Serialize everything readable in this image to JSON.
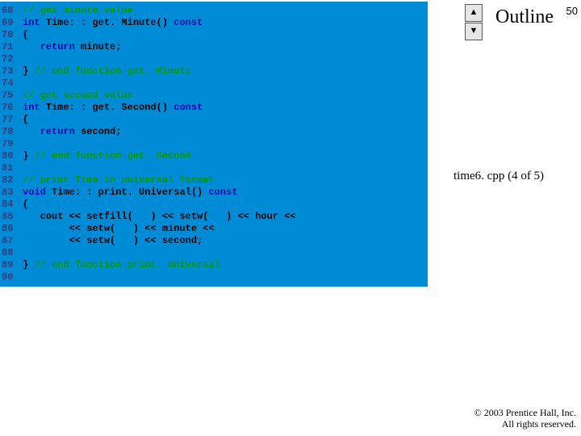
{
  "header": {
    "outline_label": "Outline",
    "page_number": "50"
  },
  "sidebar": {
    "file_label": "time6. cpp (4 of 5)"
  },
  "footer": {
    "copyright_line1": "© 2003 Prentice Hall, Inc.",
    "copyright_line2": "All rights reserved."
  },
  "nav": {
    "up_glyph": "▲",
    "down_glyph": "▼"
  },
  "code": {
    "lines": [
      {
        "n": "68",
        "tokens": [
          {
            "c": "comment",
            "t": "// get minute value"
          }
        ]
      },
      {
        "n": "69",
        "tokens": [
          {
            "c": "keyword",
            "t": "int"
          },
          {
            "c": "default",
            "t": " Time: : get. Minute() "
          },
          {
            "c": "keyword",
            "t": "const"
          }
        ]
      },
      {
        "n": "70",
        "tokens": [
          {
            "c": "default",
            "t": "{"
          }
        ]
      },
      {
        "n": "71",
        "tokens": [
          {
            "c": "default",
            "t": "   "
          },
          {
            "c": "keyword",
            "t": "return"
          },
          {
            "c": "default",
            "t": " minute;"
          }
        ]
      },
      {
        "n": "72",
        "tokens": []
      },
      {
        "n": "73",
        "tokens": [
          {
            "c": "default",
            "t": "} "
          },
          {
            "c": "comment",
            "t": "// end function get. Minute"
          }
        ]
      },
      {
        "n": "74",
        "tokens": []
      },
      {
        "n": "75",
        "tokens": [
          {
            "c": "comment",
            "t": "// get second value"
          }
        ]
      },
      {
        "n": "76",
        "tokens": [
          {
            "c": "keyword",
            "t": "int"
          },
          {
            "c": "default",
            "t": " Time: : get. Second() "
          },
          {
            "c": "keyword",
            "t": "const"
          }
        ]
      },
      {
        "n": "77",
        "tokens": [
          {
            "c": "default",
            "t": "{"
          }
        ]
      },
      {
        "n": "78",
        "tokens": [
          {
            "c": "default",
            "t": "   "
          },
          {
            "c": "keyword",
            "t": "return"
          },
          {
            "c": "default",
            "t": " second;"
          }
        ]
      },
      {
        "n": "79",
        "tokens": []
      },
      {
        "n": "80",
        "tokens": [
          {
            "c": "default",
            "t": "} "
          },
          {
            "c": "comment",
            "t": "// end function get. Second"
          }
        ]
      },
      {
        "n": "81",
        "tokens": []
      },
      {
        "n": "82",
        "tokens": [
          {
            "c": "comment",
            "t": "// print Time in universal format"
          }
        ]
      },
      {
        "n": "83",
        "tokens": [
          {
            "c": "keyword",
            "t": "void"
          },
          {
            "c": "default",
            "t": " Time: : print. Universal() "
          },
          {
            "c": "keyword",
            "t": "const"
          }
        ]
      },
      {
        "n": "84",
        "tokens": [
          {
            "c": "default",
            "t": "{"
          }
        ]
      },
      {
        "n": "85",
        "tokens": [
          {
            "c": "default",
            "t": "   cout << setfill( "
          },
          {
            "c": "string",
            "t": " "
          },
          {
            "c": "default",
            "t": " ) << setw( "
          },
          {
            "c": "string",
            "t": " "
          },
          {
            "c": "default",
            "t": " ) << hour << "
          },
          {
            "c": "string",
            "t": " "
          }
        ]
      },
      {
        "n": "86",
        "tokens": [
          {
            "c": "default",
            "t": "        << setw( "
          },
          {
            "c": "string",
            "t": " "
          },
          {
            "c": "default",
            "t": " ) << minute << "
          },
          {
            "c": "string",
            "t": " "
          }
        ]
      },
      {
        "n": "87",
        "tokens": [
          {
            "c": "default",
            "t": "        << setw( "
          },
          {
            "c": "string",
            "t": " "
          },
          {
            "c": "default",
            "t": " ) << second;"
          }
        ]
      },
      {
        "n": "88",
        "tokens": []
      },
      {
        "n": "89",
        "tokens": [
          {
            "c": "default",
            "t": "} "
          },
          {
            "c": "comment",
            "t": "// end function print. Universal"
          }
        ]
      },
      {
        "n": "90",
        "tokens": []
      }
    ]
  }
}
